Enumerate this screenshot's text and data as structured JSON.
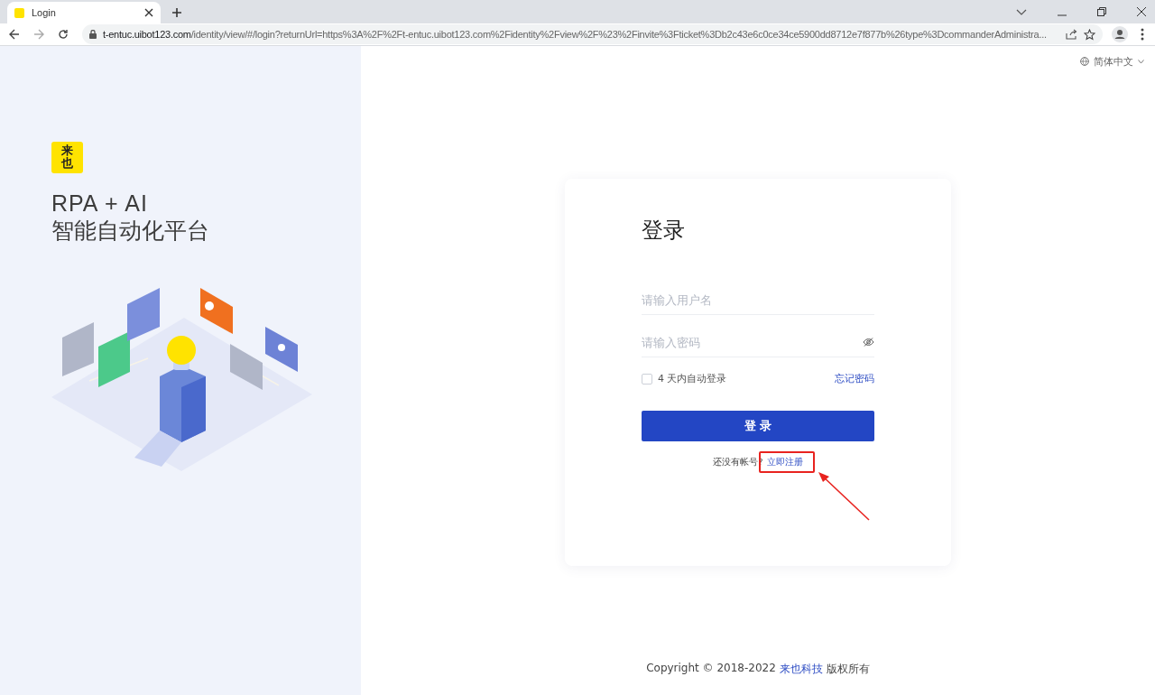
{
  "browser": {
    "tab": {
      "title": "Login"
    },
    "url": {
      "host": "t-entuc.uibot123.com",
      "path": "/identity/view/#/login?returnUrl=https%3A%2F%2Ft-entuc.uibot123.com%2Fidentity%2Fview%2F%23%2Finvite%3Fticket%3Db2c43e6c0ce34ce5900dd8712e7f877b%26type%3DcommanderAdministra..."
    }
  },
  "brand": {
    "logo_text": "来也",
    "headline": "RPA + AI",
    "subheadline": "智能自动化平台"
  },
  "language": "简体中文",
  "login": {
    "title": "登录",
    "username": {
      "placeholder": "请输入用户名"
    },
    "password": {
      "placeholder": "请输入密码"
    },
    "remember": {
      "label": "4 天内自动登录",
      "checked": false
    },
    "forgot": "忘记密码",
    "submit": "登 录",
    "signup_prompt": "还没有帐号?",
    "signup_link": "立即注册"
  },
  "footer": {
    "copyright": "Copyright © 2018-2022",
    "company": "来也科技",
    "rights": "版权所有"
  }
}
